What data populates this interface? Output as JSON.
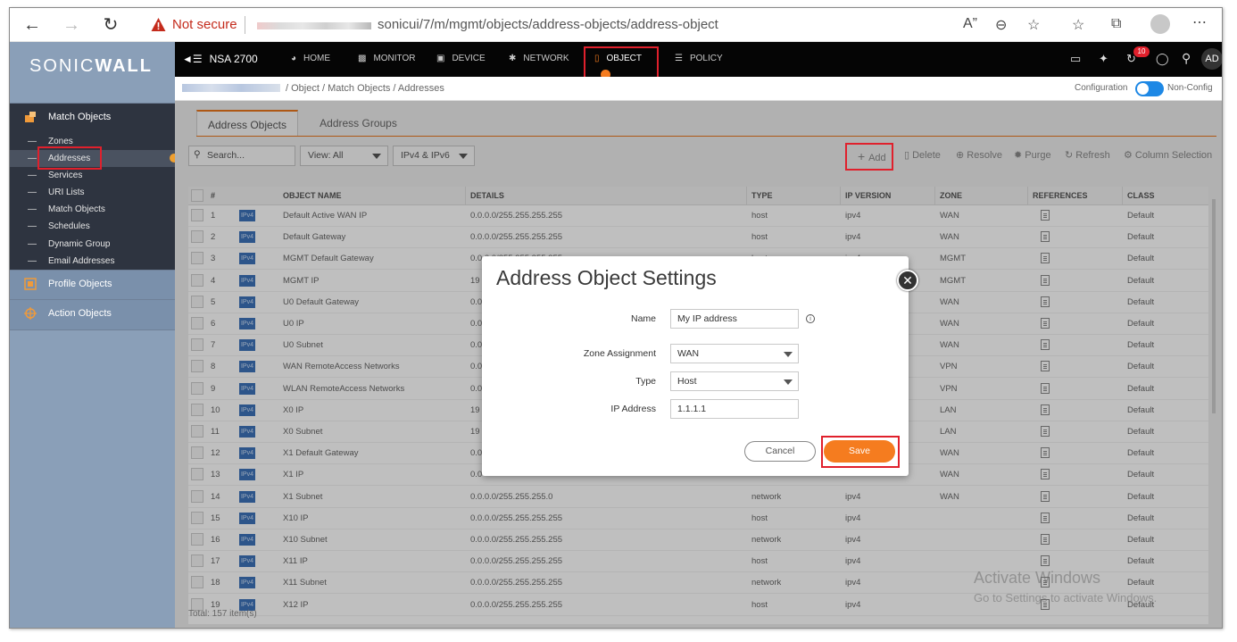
{
  "browser": {
    "not_secure": "Not secure",
    "url": "sonicui/7/m/mgmt/objects/address-objects/address-object"
  },
  "sidebar": {
    "logo_left": "SONIC",
    "logo_right": "WALL",
    "match_objects": "Match Objects",
    "items": [
      {
        "label": "Zones"
      },
      {
        "label": "Addresses"
      },
      {
        "label": "Services"
      },
      {
        "label": "URI Lists"
      },
      {
        "label": "Match Objects"
      },
      {
        "label": "Schedules"
      },
      {
        "label": "Dynamic Group"
      },
      {
        "label": "Email Addresses"
      }
    ],
    "profile_objects": "Profile Objects",
    "action_objects": "Action Objects"
  },
  "topnav": {
    "device_name": "NSA 2700",
    "items": [
      "HOME",
      "MONITOR",
      "DEVICE",
      "NETWORK",
      "OBJECT",
      "POLICY"
    ],
    "notification_count": "10",
    "user_initials": "AD"
  },
  "crumbbar": {
    "crumbs": "/  Object  /  Match Objects  /  Addresses",
    "config_label": "Configuration",
    "nonconfig_label": "Non-Config"
  },
  "tabs": {
    "address_objects": "Address Objects",
    "address_groups": "Address Groups"
  },
  "toolbar": {
    "search_placeholder": "Search...",
    "view_label": "View: All",
    "ip_filter": "IPv4 & IPv6",
    "add": "Add",
    "delete": "Delete",
    "resolve": "Resolve",
    "purge": "Purge",
    "refresh": "Refresh",
    "column_selection": "Column Selection"
  },
  "table": {
    "headers": [
      "#",
      "OBJECT NAME",
      "DETAILS",
      "TYPE",
      "IP VERSION",
      "ZONE",
      "REFERENCES",
      "CLASS"
    ],
    "badge": "IPv4",
    "rows": [
      {
        "num": "1",
        "name": "Default Active WAN IP",
        "details": "0.0.0.0/255.255.255.255",
        "type": "host",
        "ipver": "ipv4",
        "zone": "WAN",
        "class": "Default"
      },
      {
        "num": "2",
        "name": "Default Gateway",
        "details": "0.0.0.0/255.255.255.255",
        "type": "host",
        "ipver": "ipv4",
        "zone": "WAN",
        "class": "Default"
      },
      {
        "num": "3",
        "name": "MGMT Default Gateway",
        "details": "0.0.0.0/255.255.255.255",
        "type": "host",
        "ipver": "ipv4",
        "zone": "MGMT",
        "class": "Default"
      },
      {
        "num": "4",
        "name": "MGMT IP",
        "details": "19",
        "type": "",
        "ipver": "",
        "zone": "MGMT",
        "class": "Default"
      },
      {
        "num": "5",
        "name": "U0 Default Gateway",
        "details": "0.0",
        "type": "",
        "ipver": "",
        "zone": "WAN",
        "class": "Default"
      },
      {
        "num": "6",
        "name": "U0 IP",
        "details": "0.0",
        "type": "",
        "ipver": "",
        "zone": "WAN",
        "class": "Default"
      },
      {
        "num": "7",
        "name": "U0 Subnet",
        "details": "0.0",
        "type": "",
        "ipver": "",
        "zone": "WAN",
        "class": "Default"
      },
      {
        "num": "8",
        "name": "WAN RemoteAccess Networks",
        "details": "0.0",
        "type": "",
        "ipver": "",
        "zone": "VPN",
        "class": "Default"
      },
      {
        "num": "9",
        "name": "WLAN RemoteAccess Networks",
        "details": "0.0",
        "type": "",
        "ipver": "",
        "zone": "VPN",
        "class": "Default"
      },
      {
        "num": "10",
        "name": "X0 IP",
        "details": "19",
        "type": "",
        "ipver": "",
        "zone": "LAN",
        "class": "Default"
      },
      {
        "num": "11",
        "name": "X0 Subnet",
        "details": "19",
        "type": "",
        "ipver": "",
        "zone": "LAN",
        "class": "Default"
      },
      {
        "num": "12",
        "name": "X1 Default Gateway",
        "details": "0.0",
        "type": "",
        "ipver": "",
        "zone": "WAN",
        "class": "Default"
      },
      {
        "num": "13",
        "name": "X1 IP",
        "details": "0.0",
        "type": "",
        "ipver": "",
        "zone": "WAN",
        "class": "Default"
      },
      {
        "num": "14",
        "name": "X1 Subnet",
        "details": "0.0.0.0/255.255.255.0",
        "type": "network",
        "ipver": "ipv4",
        "zone": "WAN",
        "class": "Default"
      },
      {
        "num": "15",
        "name": "X10 IP",
        "details": "0.0.0.0/255.255.255.255",
        "type": "host",
        "ipver": "ipv4",
        "zone": "",
        "class": "Default"
      },
      {
        "num": "16",
        "name": "X10 Subnet",
        "details": "0.0.0.0/255.255.255.255",
        "type": "network",
        "ipver": "ipv4",
        "zone": "",
        "class": "Default"
      },
      {
        "num": "17",
        "name": "X11 IP",
        "details": "0.0.0.0/255.255.255.255",
        "type": "host",
        "ipver": "ipv4",
        "zone": "",
        "class": "Default"
      },
      {
        "num": "18",
        "name": "X11 Subnet",
        "details": "0.0.0.0/255.255.255.255",
        "type": "network",
        "ipver": "ipv4",
        "zone": "",
        "class": "Default"
      },
      {
        "num": "19",
        "name": "X12 IP",
        "details": "0.0.0.0/255.255.255.255",
        "type": "host",
        "ipver": "ipv4",
        "zone": "",
        "class": "Default"
      }
    ],
    "total": "Total: 157 item(s)"
  },
  "dialog": {
    "title": "Address Object Settings",
    "name_label": "Name",
    "name_value": "My IP address",
    "zone_label": "Zone Assignment",
    "zone_value": "WAN",
    "type_label": "Type",
    "type_value": "Host",
    "ip_label": "IP Address",
    "ip_value": "1.1.1.1",
    "cancel": "Cancel",
    "save": "Save"
  },
  "watermark": {
    "line1": "Activate Windows",
    "line2": "Go to Settings to activate Windows."
  },
  "colors": {
    "accent": "#f57c1f",
    "highlight_box": "#e0202c",
    "sidebar": "#8a9fb8",
    "topnav": "#050505"
  }
}
